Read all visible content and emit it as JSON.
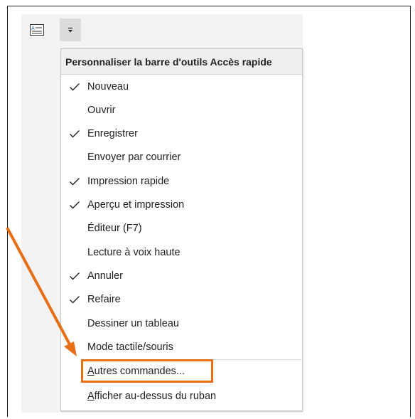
{
  "colors": {
    "accent": "#e66e14",
    "menu_bg": "#ffffff",
    "header_bg": "#efefef",
    "ribbon_bg": "#f3f3f3"
  },
  "toolbar": {
    "left_icon": "form-icon",
    "dropdown_icon": "customize-dropdown-icon"
  },
  "menu": {
    "title": "Personnaliser la barre d'outils Accès rapide",
    "items": [
      {
        "label": "Nouveau",
        "checked": true
      },
      {
        "label": "Ouvrir",
        "checked": false
      },
      {
        "label": "Enregistrer",
        "checked": true
      },
      {
        "label": "Envoyer par courrier",
        "checked": false
      },
      {
        "label": "Impression rapide",
        "checked": true
      },
      {
        "label": "Aperçu et impression",
        "checked": true
      },
      {
        "label": "Éditeur (F7)",
        "checked": false
      },
      {
        "label": "Lecture à voix haute",
        "checked": false
      },
      {
        "label": "Annuler",
        "checked": true
      },
      {
        "label": "Refaire",
        "checked": true
      },
      {
        "label": "Dessiner un tableau",
        "checked": false
      },
      {
        "label": "Mode tactile/souris",
        "checked": false
      }
    ],
    "more_commands": {
      "accel": "A",
      "rest": "utres commandes..."
    },
    "show_above": {
      "accel": "A",
      "rest": "fficher au-dessus du ruban"
    }
  }
}
